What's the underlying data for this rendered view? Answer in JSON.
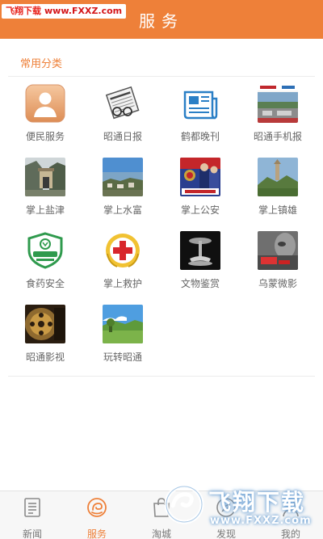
{
  "colors": {
    "accent": "#ee8039",
    "label": "#666666",
    "tab_inactive": "#777777",
    "divider": "#ececec"
  },
  "header": {
    "title": "服务",
    "watermark_cn": "飞翔下载",
    "watermark_url": "www.FXXZ.com"
  },
  "section": {
    "title": "常用分类"
  },
  "categories": [
    {
      "label": "便民服务",
      "icon": "person-service-icon"
    },
    {
      "label": "昭通日报",
      "icon": "newspaper-glasses-icon"
    },
    {
      "label": "鹤都晚刊",
      "icon": "newspaper-icon"
    },
    {
      "label": "昭通手机报",
      "icon": "mobile-news-thumbnail"
    },
    {
      "label": "掌上盐津",
      "icon": "yanjin-photo"
    },
    {
      "label": "掌上水富",
      "icon": "shuifu-photo"
    },
    {
      "label": "掌上公安",
      "icon": "police-photo"
    },
    {
      "label": "掌上镇雄",
      "icon": "zhenxiong-photo"
    },
    {
      "label": "食药安全",
      "icon": "food-drug-safety-badge"
    },
    {
      "label": "掌上救护",
      "icon": "red-cross-icon"
    },
    {
      "label": "文物鉴赏",
      "icon": "cultural-relic-photo"
    },
    {
      "label": "乌蒙微影",
      "icon": "wumeng-film-photo"
    },
    {
      "label": "昭通影视",
      "icon": "film-reel-photo"
    },
    {
      "label": "玩转昭通",
      "icon": "landscape-photo"
    }
  ],
  "tabbar": {
    "tabs": [
      {
        "label": "新闻",
        "icon": "news-icon",
        "active": false
      },
      {
        "label": "服务",
        "icon": "service-icon",
        "active": true
      },
      {
        "label": "淘城",
        "icon": "shopping-bag-icon",
        "active": false
      },
      {
        "label": "发现",
        "icon": "discover-icon",
        "active": false
      },
      {
        "label": "我的",
        "icon": "profile-icon",
        "active": false
      }
    ]
  },
  "watermark": {
    "cn": "飞翔下载",
    "url": "www.FXXZ.com"
  }
}
